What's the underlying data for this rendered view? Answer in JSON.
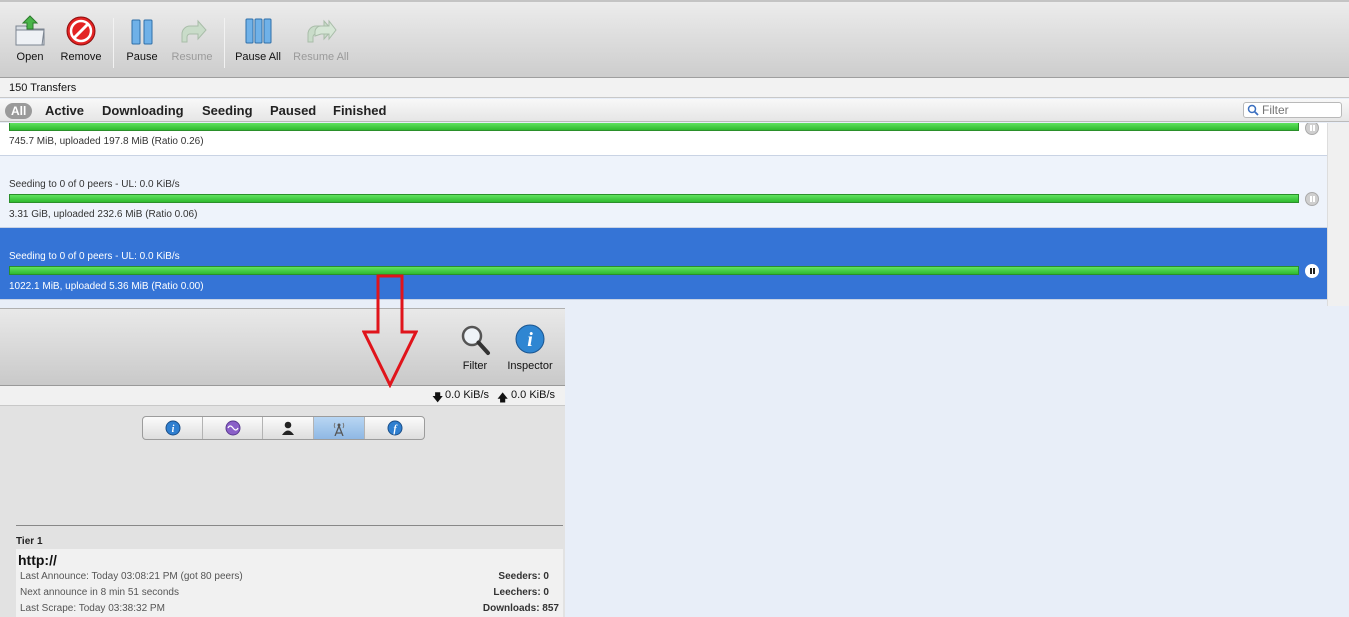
{
  "toolbar": {
    "open": "Open",
    "remove": "Remove",
    "pause": "Pause",
    "resume": "Resume",
    "pause_all": "Pause All",
    "resume_all": "Resume All"
  },
  "transfers_count": "150 Transfers",
  "filter_tabs": [
    "All",
    "Active",
    "Downloading",
    "Seeding",
    "Paused",
    "Finished"
  ],
  "filter_tabs_selected": "All",
  "filter_placeholder": "Filter",
  "torrents": [
    {
      "status": "",
      "progress": 1.0,
      "summary": "745.7 MiB, uploaded 197.8 MiB (Ratio 0.26)",
      "selected": false
    },
    {
      "status": "Seeding to 0 of 0 peers - UL: 0.0 KiB/s",
      "progress": 1.0,
      "summary": "3.31 GiB, uploaded 232.6 MiB (Ratio 0.06)",
      "selected": false
    },
    {
      "status": "Seeding to 0 of 0 peers - UL: 0.0 KiB/s",
      "progress": 1.0,
      "summary": "1022.1 MiB, uploaded 5.36 MiB (Ratio 0.00)",
      "selected": true
    }
  ],
  "bottom_toolbar": {
    "filter": "Filter",
    "inspector": "Inspector"
  },
  "speeds": {
    "down": "0.0 KiB/s",
    "up": "0.0 KiB/s"
  },
  "inspector_tabs": [
    "info-icon",
    "activity-icon",
    "peers-icon",
    "trackers-icon",
    "files-icon"
  ],
  "inspector_tab_selected": "trackers-icon",
  "tracker": {
    "tier": "Tier 1",
    "url": "http://",
    "last_announce": "Last Announce: Today 03:08:21 PM (got 80 peers)",
    "next_announce": "Next announce in 8 min 51 seconds",
    "last_scrape": "Last Scrape: Today 03:38:32 PM",
    "seeders": "Seeders: 0",
    "leechers": "Leechers: 0",
    "downloads": "Downloads: 857"
  },
  "colors": {
    "selection": "#3574d6",
    "progress_green": "#3fcf3f",
    "arrow_red": "#e0141b"
  }
}
